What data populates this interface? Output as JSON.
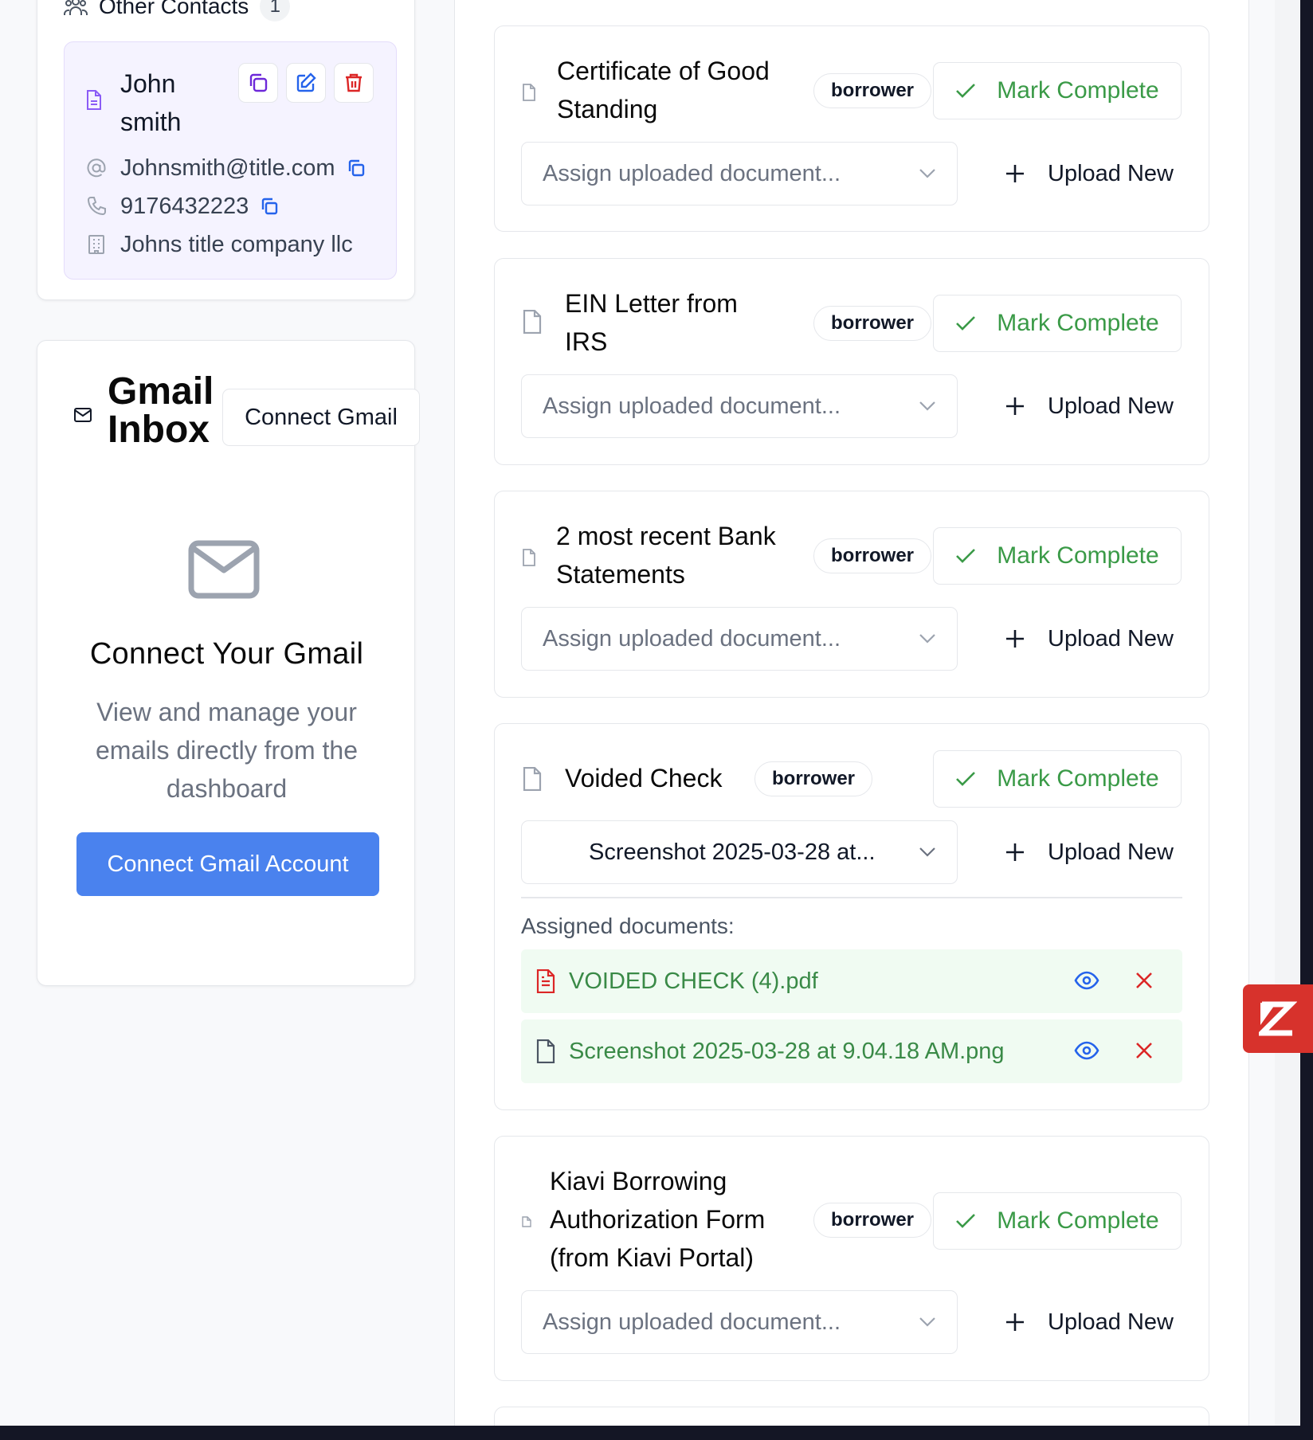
{
  "contacts": {
    "title": "Other Contacts",
    "count": "1",
    "items": [
      {
        "name": "John smith",
        "email": "Johnsmith@title.com",
        "phone": "9176432223",
        "company": "Johns title company llc"
      }
    ]
  },
  "gmail": {
    "title": "Gmail Inbox",
    "connect_button": "Connect Gmail",
    "heading": "Connect Your Gmail",
    "description": "View and manage your emails directly from the dashboard",
    "connect_account_button": "Connect Gmail Account"
  },
  "documents": {
    "mark_complete_label": "Mark Complete",
    "upload_label": "Upload New",
    "assign_placeholder": "Assign uploaded document...",
    "assigned_label": "Assigned documents:",
    "items": [
      {
        "title": "Certificate of Good Standing",
        "role": "borrower"
      },
      {
        "title": "EIN Letter from IRS",
        "role": "borrower"
      },
      {
        "title": "2 most recent Bank Statements",
        "role": "borrower"
      },
      {
        "title": "Voided Check",
        "role": "borrower",
        "selected_value": "Screenshot 2025-03-28 at...",
        "assigned": [
          {
            "name": "VOIDED CHECK (4).pdf",
            "icon": "pdf-file-icon"
          },
          {
            "name": "Screenshot 2025-03-28 at 9.04.18 AM.png",
            "icon": "file-icon"
          }
        ]
      },
      {
        "title": "Kiavi Borrowing Authorization Form (from Kiavi Portal)",
        "role": "borrower"
      }
    ]
  },
  "colors": {
    "accent_blue": "#4a82ee",
    "success_green": "#3a9a47",
    "danger_red": "#dc2626",
    "contact_bg": "#f5f3ff",
    "widget_red": "#d7322c"
  }
}
